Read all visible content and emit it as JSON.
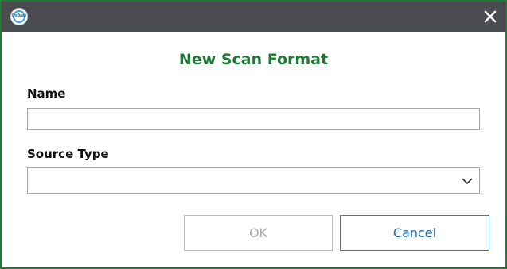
{
  "window": {
    "app_logo_text": "OnBase",
    "close_icon": "close-icon"
  },
  "dialog": {
    "title": "New Scan Format"
  },
  "form": {
    "name": {
      "label": "Name",
      "value": ""
    },
    "source_type": {
      "label": "Source Type",
      "selected": ""
    }
  },
  "buttons": {
    "ok_label": "OK",
    "ok_enabled": false,
    "cancel_label": "Cancel"
  },
  "colors": {
    "accent_green": "#1e7a34",
    "titlebar": "#4a4b4f",
    "cancel_blue": "#1f6fb8"
  }
}
